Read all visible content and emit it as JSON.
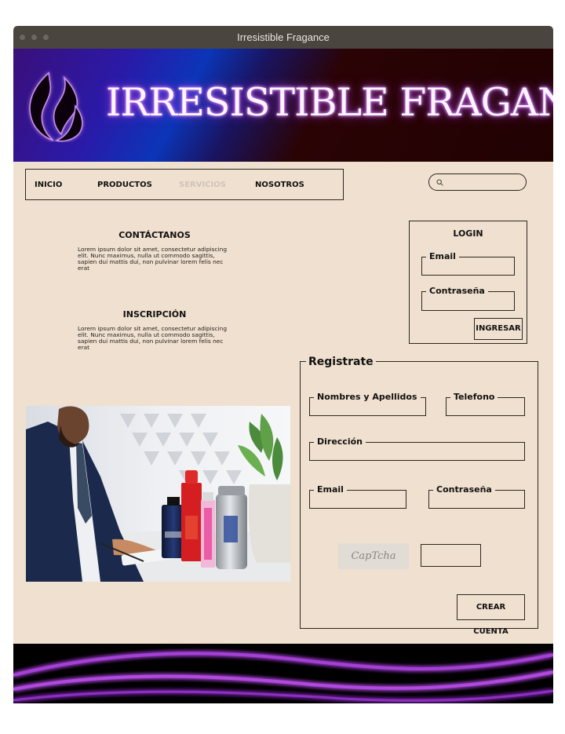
{
  "window": {
    "title": "Irresistible Fragance"
  },
  "banner": {
    "brand": "IRRESISTIBLE FRAGANCE",
    "logo_icon": "flame-logo-icon"
  },
  "nav": {
    "items": [
      "INICIO",
      "PRODUCTOS",
      "SERVICIOS",
      "NOSOTROS"
    ],
    "disabled_item": "SERVICIOS"
  },
  "search": {
    "placeholder": "",
    "icon": "search-icon"
  },
  "contact": {
    "title": "CONTÁCTANOS",
    "lines": [
      "Lorem ipsum dolor sit amet, consectetur adipiscing",
      "elit. Nunc maximus, nulla ut commodo sagittis,",
      "sapien dui mattis dui, non pulvinar lorem felis nec",
      "erat"
    ]
  },
  "inscription": {
    "title": "INSCRIPCIÓN",
    "lines": [
      "Lorem ipsum dolor sit amet, consectetur adipiscing",
      "elit. Nunc maximus, nulla ut commodo sagittis,",
      "sapien dui mattis dui, non pulvinar lorem felis nec",
      "erat"
    ]
  },
  "login": {
    "title": "LOGIN",
    "email_label": "Email",
    "email_value": "",
    "password_label": "Contraseña",
    "password_value": "",
    "submit": "INGRESAR"
  },
  "register": {
    "title": "Registrate",
    "name_label": "Nombres y Apellidos",
    "phone_label": "Telefono",
    "address_label": "Dirección",
    "email_label": "Email",
    "password_label": "Contraseña",
    "captcha_text": "CapTcha",
    "captcha_value": "",
    "submit": "CREAR CUENTA"
  },
  "colors": {
    "page_background": "#f0e0cf",
    "titlebar": "#4b4540",
    "neon": "#b14ae0"
  }
}
